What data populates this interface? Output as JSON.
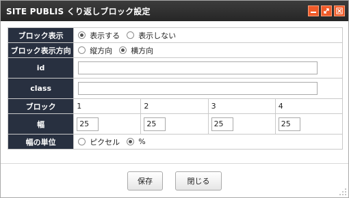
{
  "window": {
    "title": "SITE PUBLIS くり返しブロック設定",
    "accent_color": "#f05a28",
    "controls": [
      "minimize-icon",
      "maximize-icon",
      "close-icon"
    ]
  },
  "form": {
    "block_display": {
      "label": "ブロック表示",
      "options": [
        {
          "label": "表示する",
          "checked": true
        },
        {
          "label": "表示しない",
          "checked": false
        }
      ]
    },
    "block_direction": {
      "label": "ブロック表示方向",
      "options": [
        {
          "label": "縦方向",
          "checked": false
        },
        {
          "label": "横方向",
          "checked": true
        }
      ]
    },
    "id": {
      "label": "id",
      "value": ""
    },
    "class": {
      "label": "class",
      "value": ""
    },
    "blocks": {
      "label": "ブロック",
      "columns": [
        "1",
        "2",
        "3",
        "4"
      ]
    },
    "width": {
      "label": "幅",
      "values": [
        "25",
        "25",
        "25",
        "25"
      ]
    },
    "width_unit": {
      "label": "幅の単位",
      "options": [
        {
          "label": "ピクセル",
          "checked": false
        },
        {
          "label": "%",
          "checked": true
        }
      ]
    }
  },
  "footer": {
    "save_label": "保存",
    "close_label": "閉じる"
  }
}
